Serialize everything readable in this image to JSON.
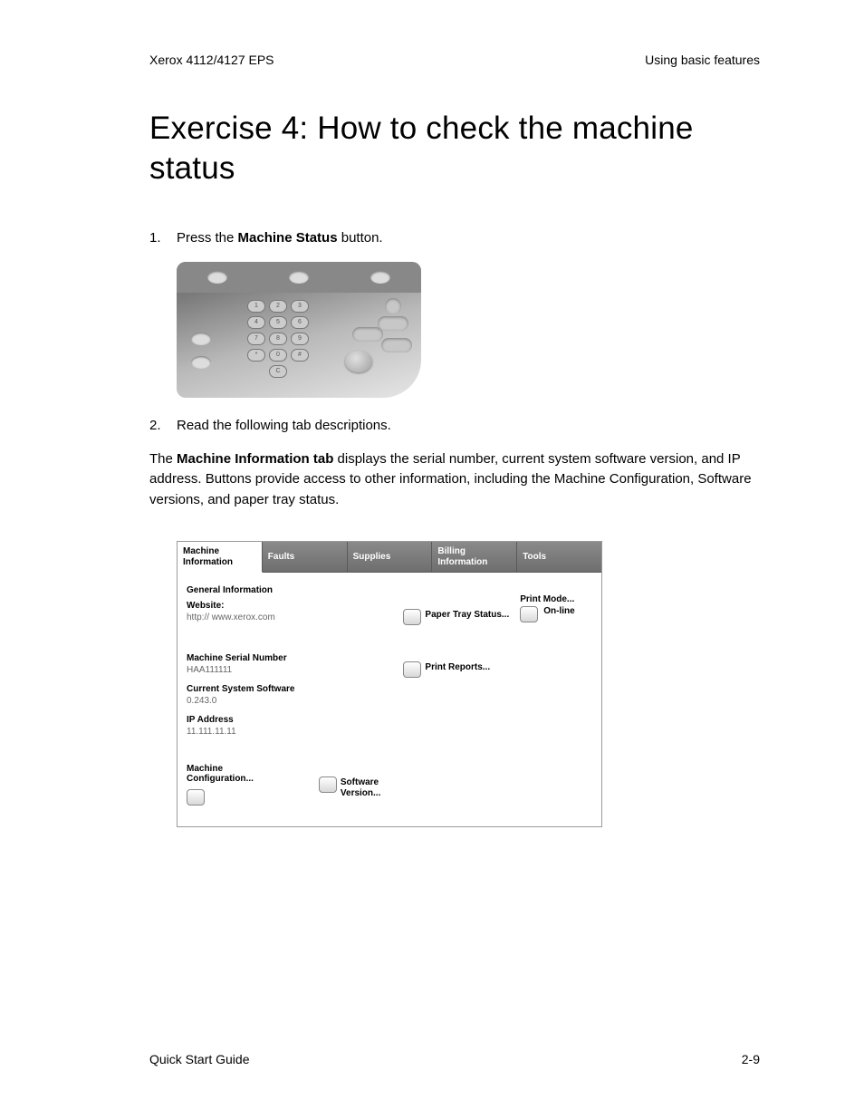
{
  "header": {
    "left": "Xerox 4112/4127 EPS",
    "right": "Using basic features"
  },
  "title": "Exercise 4: How to check the machine status",
  "steps": {
    "s1": {
      "num": "1.",
      "pre": "Press the ",
      "bold": "Machine Status",
      "post": " button."
    },
    "s2": {
      "num": "2.",
      "text": "Read the following tab descriptions."
    }
  },
  "para": {
    "pre": "The ",
    "bold": "Machine Information tab",
    "post": " displays the serial number, current system software version, and IP address. Buttons provide access to other information, including the Machine Configuration, Software versions, and paper tray status."
  },
  "keypad": [
    "1",
    "2",
    "3",
    "4",
    "5",
    "6",
    "7",
    "8",
    "9",
    "*",
    "0",
    "#",
    "",
    "C",
    ""
  ],
  "ui": {
    "tabs": [
      "Machine Information",
      "Faults",
      "Supplies",
      "Billing Information",
      "Tools"
    ],
    "general_title": "General Information",
    "website_label": "Website:",
    "website_val": "http:// www.xerox.com",
    "serial_label": "Machine Serial Number",
    "serial_val": "HAA111111",
    "sw_label": "Current System Software",
    "sw_val": "0.243.0",
    "ip_label": "IP Address",
    "ip_val": "11.111.11.11",
    "machine_config": "Machine Configuration...",
    "software_version": "Software Version...",
    "paper_tray": "Paper Tray Status...",
    "print_mode": "Print Mode...",
    "online": "On-line",
    "print_reports": "Print Reports..."
  },
  "footer": {
    "left": "Quick Start Guide",
    "right": "2-9"
  }
}
